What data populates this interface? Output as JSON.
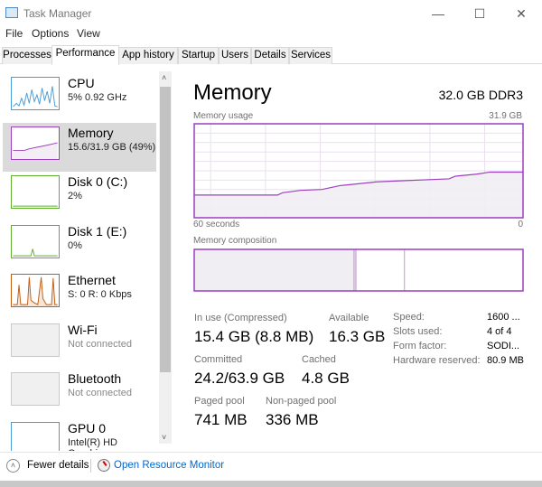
{
  "window": {
    "title": "Task Manager",
    "minimize": "—",
    "maximize": "☐",
    "close": "✕"
  },
  "menu": [
    "File",
    "Options",
    "View"
  ],
  "tabs": [
    "Processes",
    "Performance",
    "App history",
    "Startup",
    "Users",
    "Details",
    "Services"
  ],
  "active_tab": "Performance",
  "sidebar": [
    {
      "name": "CPU",
      "sub": "5% 0.92 GHz",
      "color": "#4a9bd6"
    },
    {
      "name": "Memory",
      "sub": "15.6/31.9 GB (49%)",
      "color": "#9b3fbf"
    },
    {
      "name": "Disk 0 (C:)",
      "sub": "2%",
      "color": "#5fae2e"
    },
    {
      "name": "Disk 1 (E:)",
      "sub": "0%",
      "color": "#5fae2e"
    },
    {
      "name": "Ethernet",
      "sub": "S: 0 R: 0 Kbps",
      "color": "#c25d12"
    },
    {
      "name": "Wi-Fi",
      "sub": "Not connected",
      "color": "#999999"
    },
    {
      "name": "Bluetooth",
      "sub": "Not connected",
      "color": "#999999"
    },
    {
      "name": "GPU 0",
      "sub": "Intel(R) HD Graphics",
      "color": "#4a9bd6"
    }
  ],
  "main": {
    "title": "Memory",
    "spec": "32.0 GB DDR3",
    "usage_label": "Memory usage",
    "usage_max": "31.9 GB",
    "time_left": "60 seconds",
    "time_right": "0",
    "composition_label": "Memory composition",
    "stats": {
      "in_use_label": "In use (Compressed)",
      "in_use": "15.4 GB (8.8 MB)",
      "available_label": "Available",
      "available": "16.3 GB",
      "committed_label": "Committed",
      "committed": "24.2/63.9 GB",
      "cached_label": "Cached",
      "cached": "4.8 GB",
      "paged_label": "Paged pool",
      "paged": "741 MB",
      "nonpaged_label": "Non-paged pool",
      "nonpaged": "336 MB"
    },
    "details": [
      {
        "k": "Speed:",
        "v": "1600 ..."
      },
      {
        "k": "Slots used:",
        "v": "4 of 4"
      },
      {
        "k": "Form factor:",
        "v": "SODI..."
      },
      {
        "k": "Hardware reserved:",
        "v": "80.9 MB"
      }
    ]
  },
  "chart_data": {
    "type": "area",
    "title": "Memory usage",
    "x_unit": "seconds ago",
    "xlim": [
      60,
      0
    ],
    "ylim": [
      0,
      31.9
    ],
    "grid": true,
    "x": [
      60,
      44.8,
      43.9,
      40.6,
      36.7,
      33.4,
      26.7,
      22.9,
      13.5,
      12.4,
      8.5,
      6.0,
      0
    ],
    "y": [
      7.7,
      7.7,
      8.5,
      9.3,
      9.6,
      10.9,
      12.2,
      12.5,
      13.2,
      14.1,
      14.8,
      15.5,
      15.5
    ],
    "composition": {
      "in_use": 15.5,
      "modified": 0.2,
      "standby": 4.7,
      "free": 11.5
    },
    "color": "#9b3fbf"
  },
  "footer": {
    "fewer": "Fewer details",
    "monitor": "Open Resource Monitor"
  }
}
